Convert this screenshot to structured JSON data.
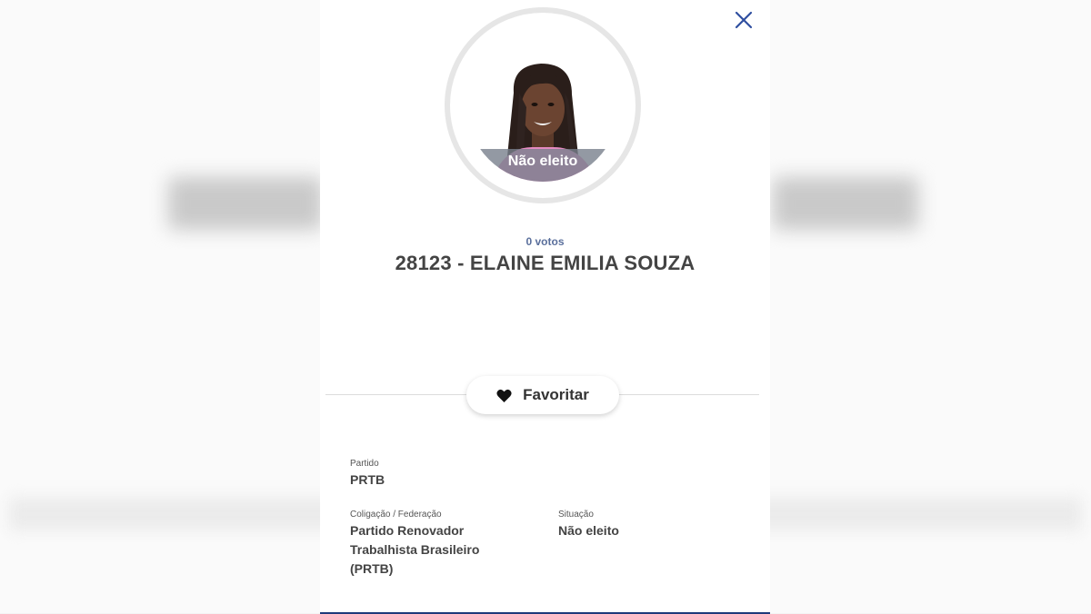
{
  "modal": {
    "close_icon": "close-icon",
    "photo_status": "Não eleito",
    "votes": "0 votos",
    "candidate_title": "28123 - ELAINE EMILIA SOUZA",
    "favorite": {
      "icon": "heart-icon",
      "label": "Favoritar"
    },
    "details": {
      "partido": {
        "label": "Partido",
        "value": "PRTB"
      },
      "coligacao": {
        "label": "Coligação / Federação",
        "value": "Partido Renovador Trabalhista Brasileiro (PRTB)"
      },
      "situacao": {
        "label": "Situação",
        "value": "Não eleito"
      }
    }
  },
  "colors": {
    "accent": "#1f3a7a",
    "close_icon": "#2f4fa0",
    "votes_text": "#5a6f9c",
    "status_overlay": "#78808c"
  }
}
